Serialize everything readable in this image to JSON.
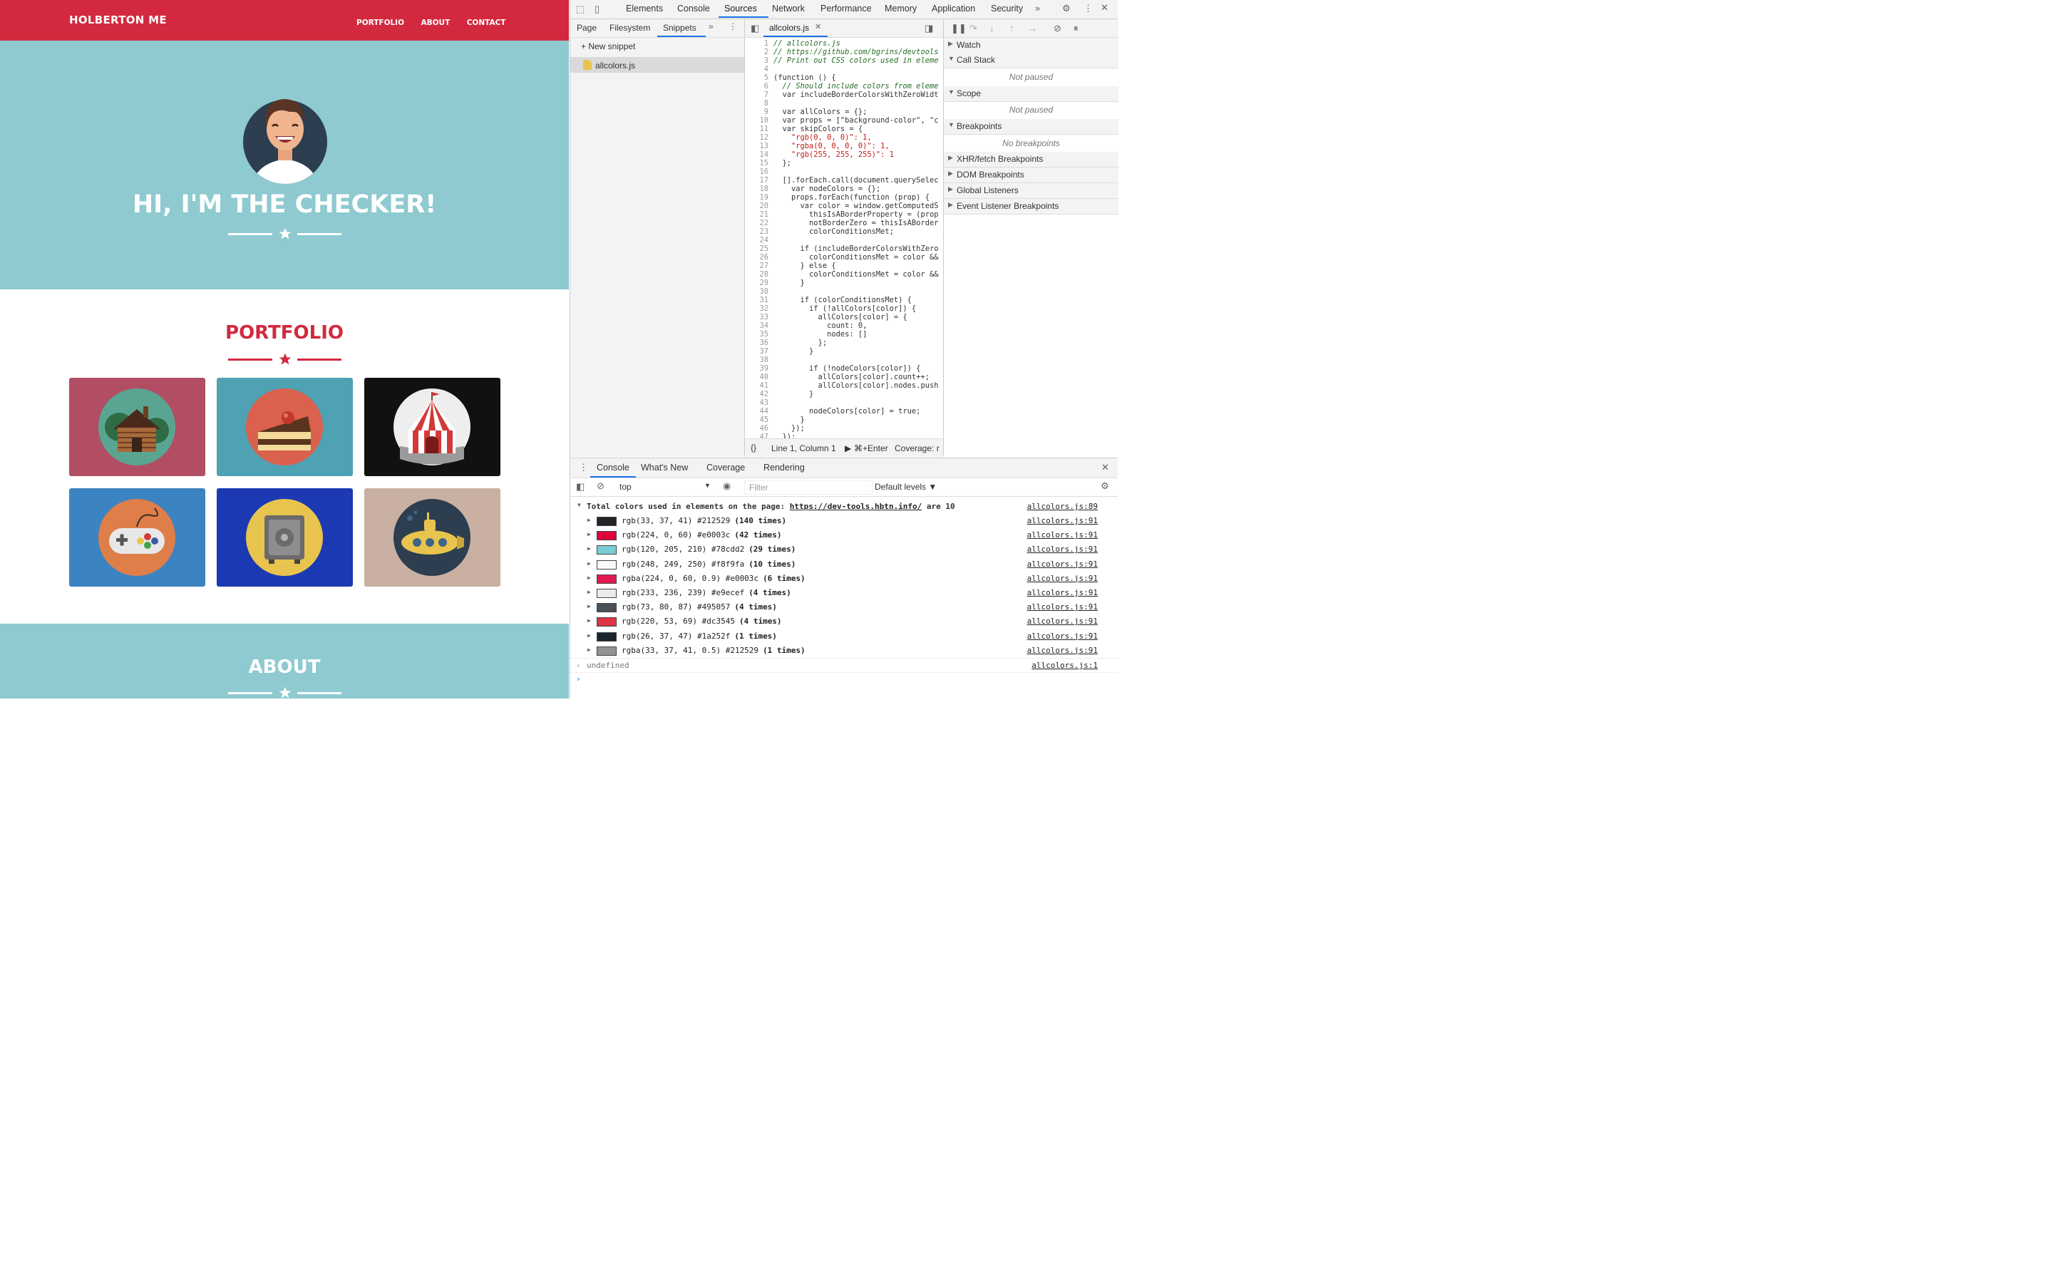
{
  "site": {
    "brand": "HOLBERTON ME",
    "nav": [
      "PORTFOLIO",
      "ABOUT",
      "CONTACT"
    ],
    "hero_title": "HI, I'M THE CHECKER!",
    "portfolio_title": "PORTFOLIO",
    "about_title": "ABOUT",
    "colors": {
      "primary": "#d2293f",
      "teal": "#8ecad0",
      "white": "#ffffff"
    },
    "tiles": [
      {
        "name": "cabin",
        "bg": "#b24e63",
        "circle": "#5aa591"
      },
      {
        "name": "cake",
        "bg": "#4ea2b4",
        "circle": "#d9614d"
      },
      {
        "name": "circus",
        "bg": "#111111",
        "circle": "#eeeeee"
      },
      {
        "name": "game",
        "bg": "#3c83c2",
        "circle": "#df7e48"
      },
      {
        "name": "safe",
        "bg": "#1a39b3",
        "circle": "#e8c44e"
      },
      {
        "name": "submarine",
        "bg": "#c9b0a2",
        "circle": "#2c3e50"
      }
    ]
  },
  "devtools": {
    "main_tabs": [
      "Elements",
      "Console",
      "Sources",
      "Network",
      "Performance",
      "Memory",
      "Application",
      "Security"
    ],
    "active_tab": "Sources",
    "nav_tabs": [
      "Page",
      "Filesystem",
      "Snippets"
    ],
    "active_nav_tab": "Snippets",
    "new_snippet": "+ New snippet",
    "snippet_file": "allcolors.js",
    "editor_tab": "allcolors.js",
    "status_position": "Line 1, Column 1",
    "status_run": "⌘+Enter",
    "status_coverage": "Coverage: r",
    "code_lines": [
      "// allcolors.js",
      "// https://github.com/bgrins/devtools",
      "// Print out CSS colors used in eleme",
      "",
      "(function () {",
      "  // Should include colors from eleme",
      "  var includeBorderColorsWithZeroWidt",
      "",
      "  var allColors = {};",
      "  var props = [\"background-color\", \"c",
      "  var skipColors = {",
      "    \"rgb(0, 0, 0)\": 1,",
      "    \"rgba(0, 0, 0, 0)\": 1,",
      "    \"rgb(255, 255, 255)\": 1",
      "  };",
      "",
      "  [].forEach.call(document.querySelec",
      "    var nodeColors = {};",
      "    props.forEach(function (prop) {",
      "      var color = window.getComputedS",
      "        thisIsABorderProperty = (prop",
      "        notBorderZero = thisIsABorder",
      "        colorConditionsMet;",
      "",
      "      if (includeBorderColorsWithZero",
      "        colorConditionsMet = color &&",
      "      } else {",
      "        colorConditionsMet = color &&",
      "      }",
      "",
      "      if (colorConditionsMet) {",
      "        if (!allColors[color]) {",
      "          allColors[color] = {",
      "            count: 0,",
      "            nodes: []",
      "          };",
      "        }",
      "",
      "        if (!nodeColors[color]) {",
      "          allColors[color].count++;",
      "          allColors[color].nodes.push",
      "        }",
      "",
      "        nodeColors[color] = true;",
      "      }",
      "    });",
      "  });"
    ],
    "debugger": {
      "sections": [
        "Watch",
        "Call Stack",
        "Scope",
        "Breakpoints",
        "XHR/fetch Breakpoints",
        "DOM Breakpoints",
        "Global Listeners",
        "Event Listener Breakpoints"
      ],
      "call_stack_msg": "Not paused",
      "scope_msg": "Not paused",
      "breakpoints_msg": "No breakpoints"
    },
    "drawer_tabs": [
      "Console",
      "What's New",
      "Coverage",
      "Rendering"
    ],
    "context": "top",
    "filter_placeholder": "Filter",
    "levels": "Default levels ▼",
    "summary_prefix": "Total colors used in elements on the page:",
    "summary_link": "https://dev-tools.hbtn.info/",
    "summary_suffix": "are 10",
    "summary_src": "allcolors.js:89",
    "entries": [
      {
        "text": "rgb(33, 37, 41) #212529",
        "count": "(140 times)",
        "swatch": "#212529",
        "src": "allcolors.js:91"
      },
      {
        "text": "rgb(224, 0, 60) #e0003c",
        "count": "(42 times)",
        "swatch": "#e0003c",
        "src": "allcolors.js:91"
      },
      {
        "text": "rgb(120, 205, 210) #78cdd2",
        "count": "(29 times)",
        "swatch": "#78cdd2",
        "src": "allcolors.js:91"
      },
      {
        "text": "rgb(248, 249, 250) #f8f9fa",
        "count": "(10 times)",
        "swatch": "#f8f9fa",
        "src": "allcolors.js:91"
      },
      {
        "text": "rgba(224, 0, 60, 0.9) #e0003c",
        "count": "(6 times)",
        "swatch": "#e31a50",
        "src": "allcolors.js:91"
      },
      {
        "text": "rgb(233, 236, 239) #e9ecef",
        "count": "(4 times)",
        "swatch": "#e9ecef",
        "src": "allcolors.js:91"
      },
      {
        "text": "rgb(73, 80, 87) #495057",
        "count": "(4 times)",
        "swatch": "#495057",
        "src": "allcolors.js:91"
      },
      {
        "text": "rgb(220, 53, 69) #dc3545",
        "count": "(4 times)",
        "swatch": "#dc3545",
        "src": "allcolors.js:91"
      },
      {
        "text": "rgb(26, 37, 47) #1a252f",
        "count": "(1 times)",
        "swatch": "#1a252f",
        "src": "allcolors.js:91"
      },
      {
        "text": "rgba(33, 37, 41, 0.5) #212529",
        "count": "(1 times)",
        "swatch": "#909294",
        "src": "allcolors.js:91"
      }
    ],
    "result": "undefined",
    "result_src": "allcolors.js:1"
  }
}
